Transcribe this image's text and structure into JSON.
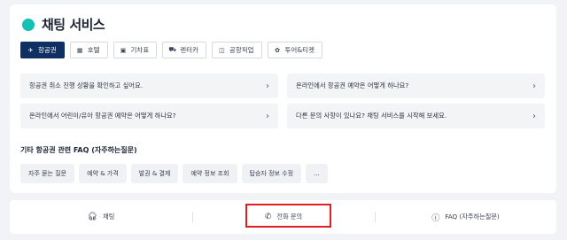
{
  "header": {
    "title": "채팅 서비스"
  },
  "tabs": [
    {
      "label": "항공권",
      "icon": "plane-icon"
    },
    {
      "label": "호텔",
      "icon": "hotel-icon"
    },
    {
      "label": "기차표",
      "icon": "train-icon"
    },
    {
      "label": "렌터카",
      "icon": "car-icon"
    },
    {
      "label": "공항픽업",
      "icon": "shuttle-icon"
    },
    {
      "label": "투어&티켓",
      "icon": "ticket-icon"
    }
  ],
  "faqs": [
    "항공권 취소 진행 상황을 확인하고 싶어요.",
    "온라인에서 항공권 예약은 어떻게 하나요?",
    "온라인에서 어린이/유아 항공권 예약은 어떻게 하나요?",
    "다른 문의 사항이 있나요? 채팅 서비스를 시작해 보세요."
  ],
  "other": {
    "title": "기타 항공권 관련 FAQ (자주하는질문)",
    "chips": [
      "자주 묻는 질문",
      "예약 & 가격",
      "발권 & 결제",
      "예약 정보 조회",
      "탑승자 정보 수정",
      "..."
    ]
  },
  "bottom": {
    "chat_label": "채팅",
    "phone_label": "전화 문의",
    "faq_label": "FAQ (자주하는질문)"
  },
  "colors": {
    "accent": "#12c2b4",
    "active_tab": "#0f3063",
    "highlight": "#e02020"
  }
}
